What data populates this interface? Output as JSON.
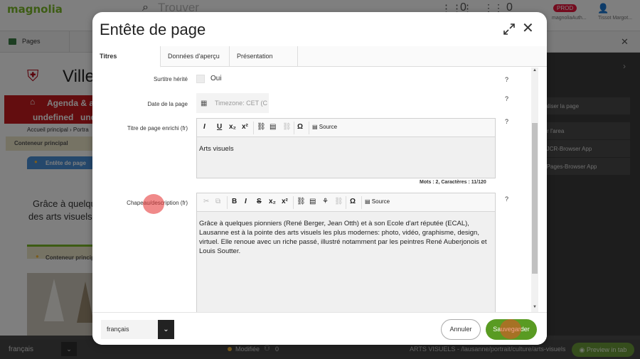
{
  "topbar": {
    "logo": "magnolia",
    "search_placeholder": "Trouver",
    "grid_count": "0",
    "bell_count": "0",
    "env_badge": "PROD",
    "env_user": "magnoliaAuth...",
    "user_name": "Tissot Margot..."
  },
  "tabbar": {
    "pages_label": "Pages"
  },
  "background_page": {
    "city": "Ville",
    "nav_label": "Agenda & act",
    "undefined1": "undefined",
    "undefined2": "und",
    "breadcrumb": "Accueil principal › Portra",
    "container_label": "Conteneur principal",
    "block_label": "Entête de page",
    "intro_line1": "Grâce à quelques",
    "intro_line2": "des arts visuels le",
    "container2_label": "Conteneur principal"
  },
  "side_panel": {
    "items": [
      "ualiser la page",
      "rer l'area",
      "n JCR-Browser App",
      "n Pages-Browser App"
    ]
  },
  "statusbar": {
    "language": "français",
    "status": "Modifiée",
    "collab_count": "0",
    "path": "ARTS VISUELS - /lausanne/portrait/culture/arts-visuels",
    "preview_label": "Preview in tab"
  },
  "dialog": {
    "title": "Entête de page",
    "tabs": [
      "Titres",
      "Données d'aperçu",
      "Présentation"
    ],
    "fields": {
      "subtitle_label": "Surtitre hérité",
      "subtitle_value": "Oui",
      "date_label": "Date de la page",
      "date_placeholder": "Timezone: CET (C",
      "rich_title_label": "Titre de page enrichi (fr)",
      "rich_title_value": "Arts visuels",
      "rich_title_count": "Mots : 2, Caractères : 11/120",
      "lead_label": "Chapeau/description (fr)",
      "lead_value": "Grâce à quelques pionniers (René Berger, Jean Otth) et à son Ecole d'art réputée (ECAL), Lausanne est à la pointe des arts visuels les plus modernes: photo, vidéo, graphisme, design, virtuel. Elle renoue avec un riche passé, illustré notamment par les peintres René Auberjonois et Louis Soutter.",
      "help": "?"
    },
    "toolbar": {
      "italic": "I",
      "underline": "U",
      "sub": "x₂",
      "sup": "x²",
      "omega": "Ω",
      "bold": "B",
      "strike": "S",
      "source": "Source"
    },
    "footer": {
      "language": "français",
      "cancel": "Annuler",
      "save": "Sauvegarder"
    }
  },
  "colors": {
    "accent": "#599b22",
    "brand_red": "#c71b1e",
    "prod_badge": "#e8173c"
  }
}
